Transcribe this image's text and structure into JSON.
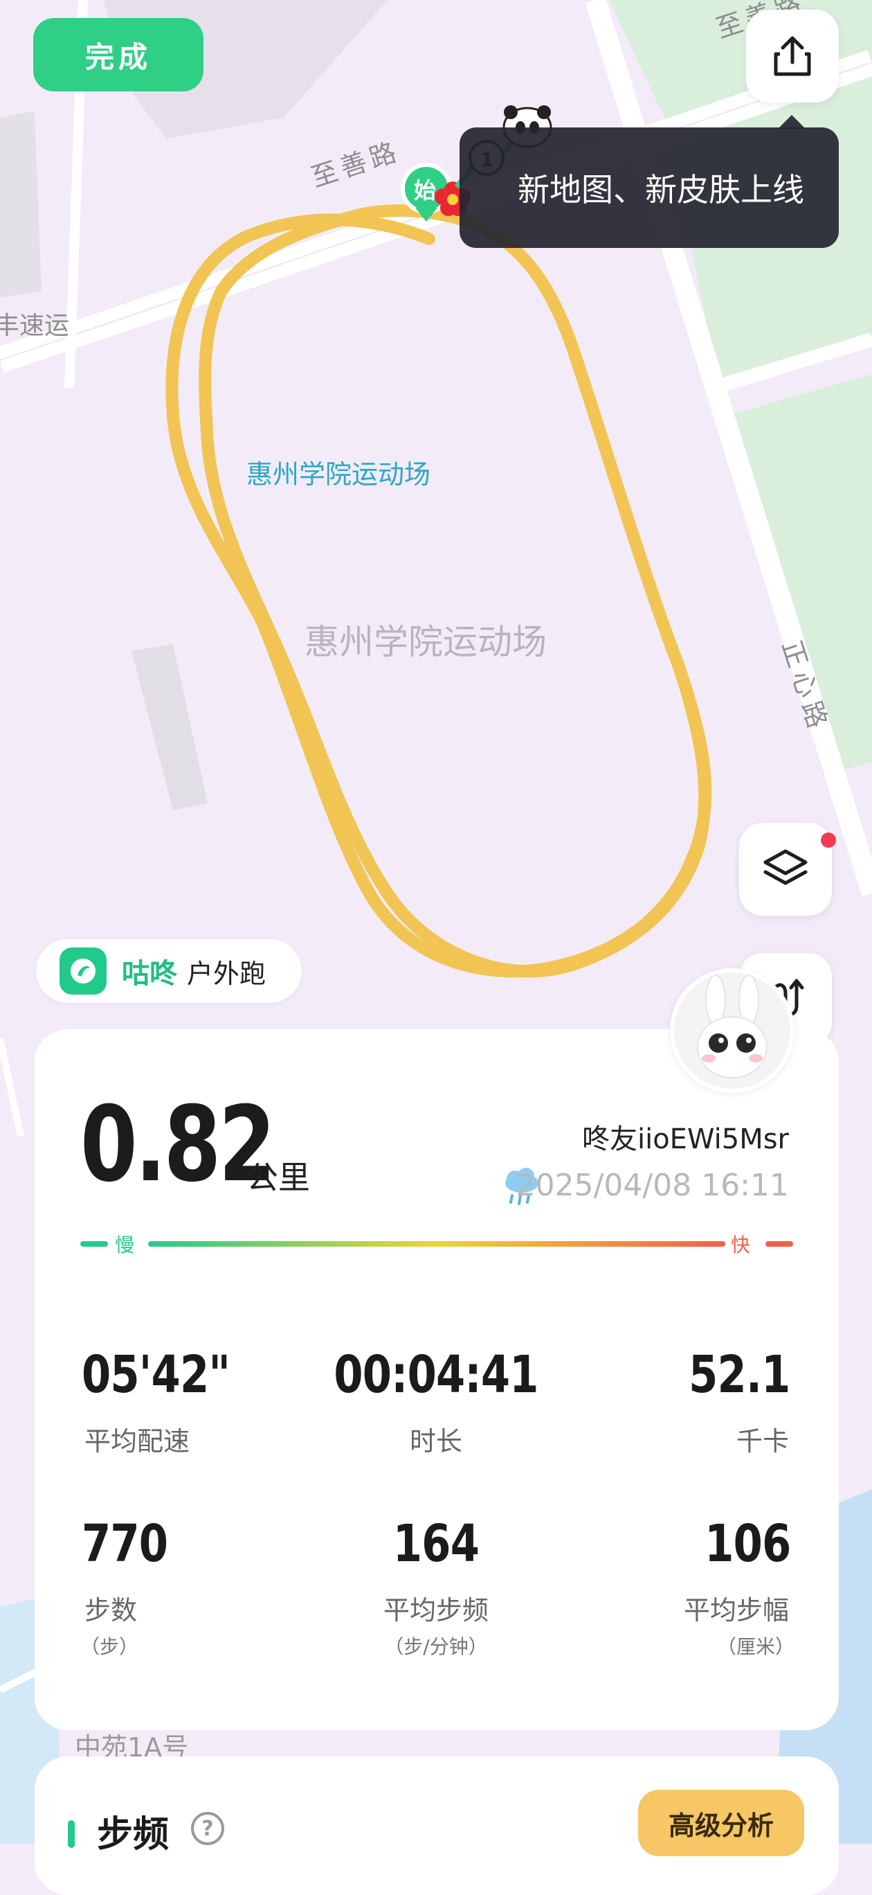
{
  "header": {
    "done_label": "完成",
    "share_icon": "share-icon"
  },
  "tooltip": {
    "text": "新地图、新皮肤上线"
  },
  "map": {
    "road_top_label": "至善路",
    "road_top_right_label": "至善路",
    "road_right_label": "正心路",
    "left_edge_label": "丰速运",
    "venue_label_blue": "惠州学院运动场",
    "venue_label_gray": "惠州学院运动场",
    "bottom_label": "中苑1A号",
    "start_marker_label": "始",
    "route_color": "#f1c453",
    "controls": [
      "layers-icon",
      "route-replay-icon"
    ]
  },
  "brand": {
    "name": "咕咚",
    "activity_type": "户外跑"
  },
  "summary": {
    "distance": "0.82",
    "distance_unit": "公里",
    "username": "咚友iioEWi5Msr",
    "datetime": "2025/04/08 16:11",
    "weather_icon": "rain-cloud-icon",
    "speed_slow_label": "慢",
    "speed_fast_label": "快",
    "stats": [
      {
        "value": "05'42\"",
        "label": "平均配速",
        "sub": ""
      },
      {
        "value": "00:04:41",
        "label": "时长",
        "sub": ""
      },
      {
        "value": "52.1",
        "label": "千卡",
        "sub": ""
      },
      {
        "value": "770",
        "label": "步数",
        "sub": "（步）"
      },
      {
        "value": "164",
        "label": "平均步频",
        "sub": "（步/分钟）"
      },
      {
        "value": "106",
        "label": "平均步幅",
        "sub": "（厘米）"
      }
    ]
  },
  "cadence_section": {
    "title": "步频",
    "help_icon": "question-mark-icon",
    "advanced_label": "高级分析"
  },
  "colors": {
    "accent": "#2fcf86",
    "route": "#f1c453",
    "speed_slow": "#27c98a",
    "speed_fast": "#f0604a"
  }
}
